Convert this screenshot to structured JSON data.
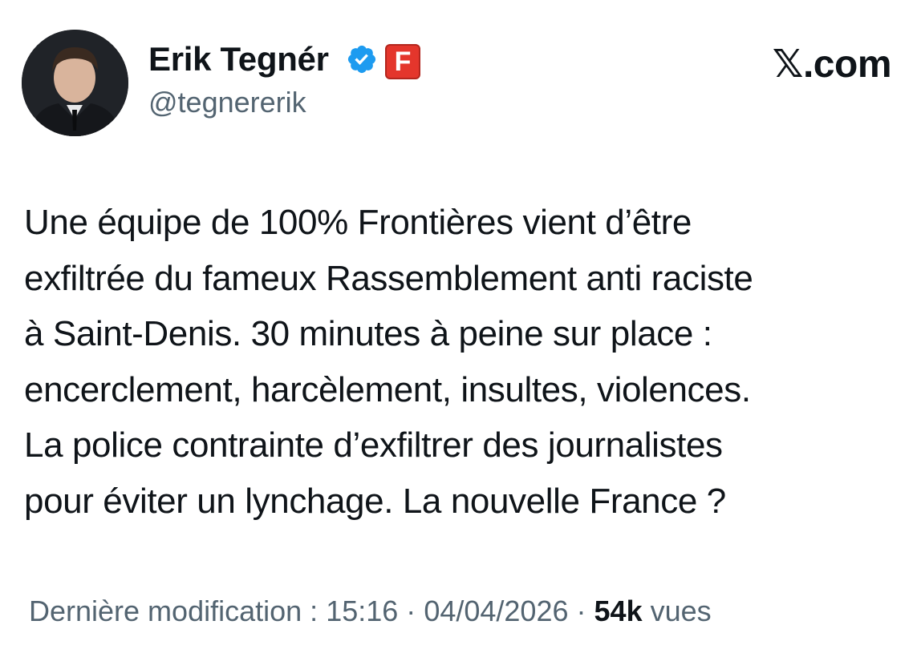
{
  "author": {
    "display_name": "Erik Tegnér",
    "handle": "@tegnererik",
    "verified_icon": "verified-badge-icon",
    "affiliate_badge_letter": "F",
    "affiliate_badge_color": "#e4362c"
  },
  "brand": {
    "logo_text": "𝕏.com"
  },
  "tweet": {
    "lines": [
      "Une équipe de 100% Frontières vient d’être",
      "exfiltrée du fameux Rassemblement anti raciste",
      "à Saint-Denis. 30 minutes à peine sur place :",
      "encerclement, harcèlement, insultes, violences.",
      "La police contrainte d’exfiltrer des journalistes",
      "pour éviter un lynchage. La nouvelle France ?"
    ]
  },
  "meta": {
    "modified_label": "Dernière modification :",
    "time": "15:16",
    "separator": "·",
    "date": "04/04/2026",
    "views_count": "54k",
    "views_label": "vues"
  },
  "colors": {
    "text_primary": "#0f1419",
    "text_secondary": "#536471",
    "verified_blue": "#1d9bf0"
  }
}
